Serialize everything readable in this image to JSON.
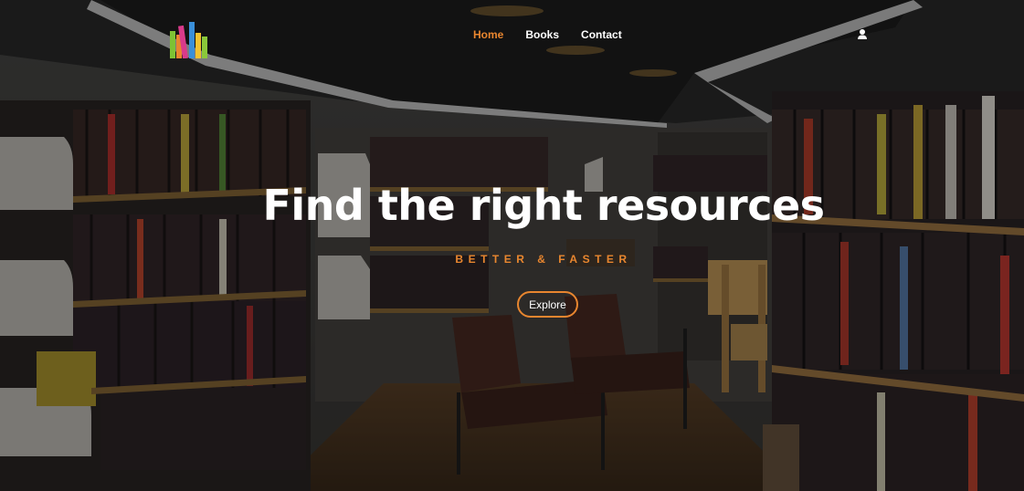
{
  "brand": {
    "logo_icon": "books-logo-icon"
  },
  "nav": {
    "items": [
      {
        "label": "Home",
        "active": true
      },
      {
        "label": "Books",
        "active": false
      },
      {
        "label": "Contact",
        "active": false
      }
    ]
  },
  "header": {
    "user_icon": "user-icon"
  },
  "hero": {
    "title": "Find the right resources",
    "tagline": "BETTER & FASTER",
    "cta_label": "Explore"
  },
  "colors": {
    "accent": "#e8862f",
    "text": "#ffffff"
  }
}
